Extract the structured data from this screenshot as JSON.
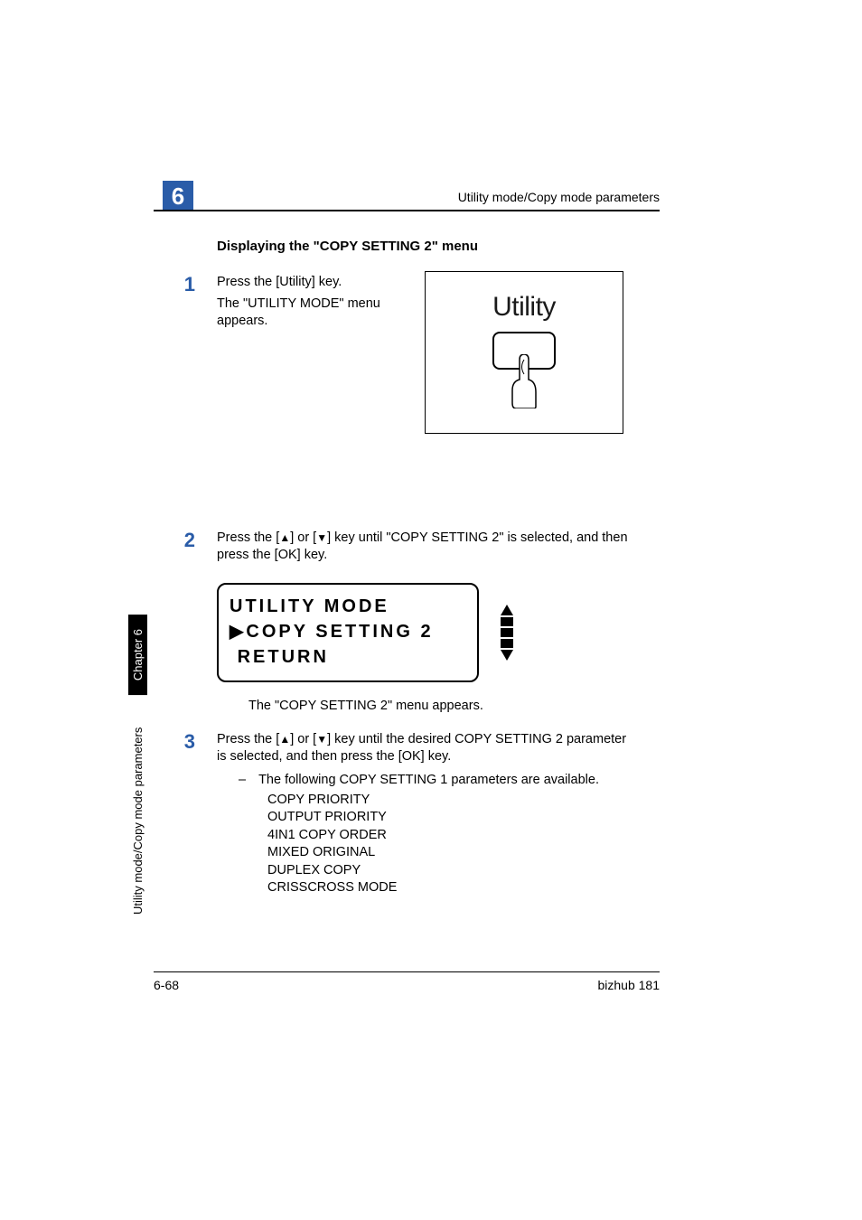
{
  "header": {
    "chapter_number": "6",
    "running_head": "Utility mode/Copy mode parameters"
  },
  "section_title": "Displaying the \"COPY SETTING 2\" menu",
  "steps": {
    "s1": {
      "num": "1",
      "line1": "Press the [Utility] key.",
      "line2": "The \"UTILITY MODE\" menu appears."
    },
    "s2": {
      "num": "2",
      "text_a": "Press the [",
      "text_b": "] or [",
      "text_c": "] key until \"COPY SETTING 2\" is selected, and then press the [OK] key."
    },
    "s3": {
      "num": "3",
      "text_a": "Press the [",
      "text_b": "] or [",
      "text_c": "] key until the desired COPY SETTING 2 parameter is selected, and then press the [OK] key.",
      "bullet_dash": "–",
      "bullet_text": "The following COPY SETTING 1 parameters are available.",
      "params": [
        "COPY PRIORITY",
        "OUTPUT PRIORITY",
        "4IN1 COPY ORDER",
        "MIXED ORIGINAL",
        "DUPLEX COPY",
        "CRISSCROSS MODE"
      ]
    }
  },
  "figure": {
    "utility_label": "Utility"
  },
  "lcd": {
    "line1": "UTILITY MODE",
    "line2_prefix": "▶",
    "line2": "COPY SETTING 2",
    "line3_indent": " ",
    "line3": "RETURN"
  },
  "result_line": "The \"COPY SETTING 2\" menu appears.",
  "side": {
    "chapter_tab": "Chapter 6",
    "section_tab": "Utility mode/Copy mode parameters"
  },
  "footer": {
    "page": "6-68",
    "model": "bizhub 181"
  },
  "glyphs": {
    "up": "▲",
    "down": "▼"
  }
}
